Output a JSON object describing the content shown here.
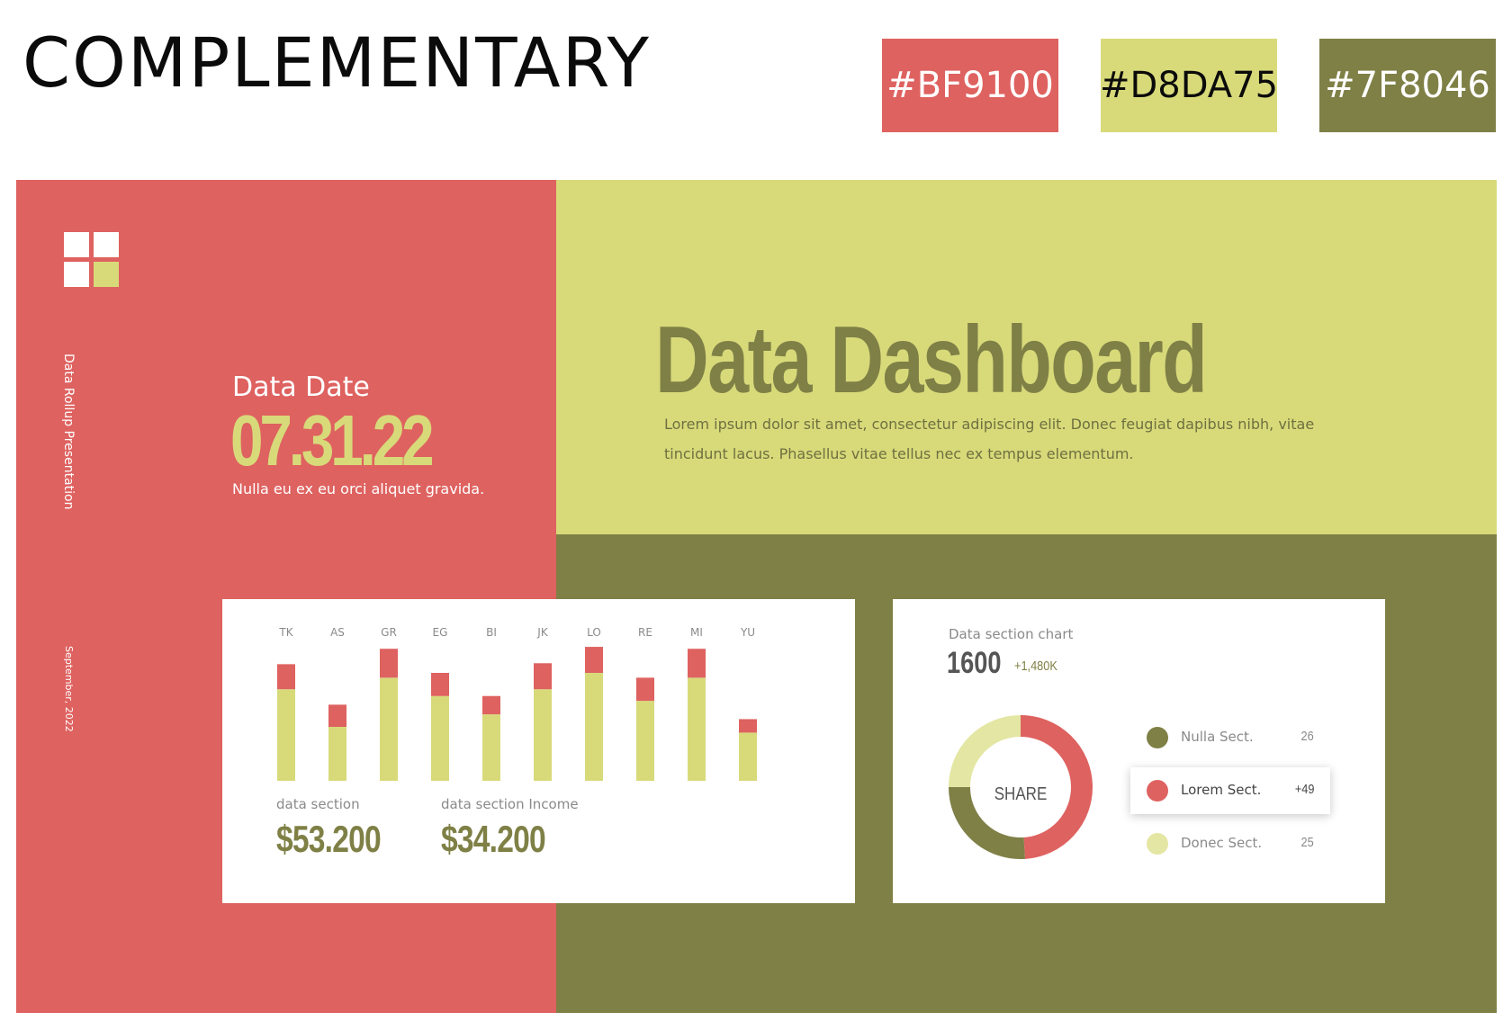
{
  "header": {
    "title": "COMPLEMENTARY",
    "swatches": [
      {
        "label": "#BF9100",
        "color": "#DE6260"
      },
      {
        "label": "#D8DA75",
        "color": "#D8DA7A"
      },
      {
        "label": "#7F8046",
        "color": "#7F8046"
      }
    ]
  },
  "sidebar": {
    "vertical_title": "Data Rollup Presentation",
    "vertical_date": "September, 2022"
  },
  "date_block": {
    "label": "Data Date",
    "value": "07.31.22",
    "subtitle": "Nulla eu ex eu orci aliquet gravida."
  },
  "dashboard": {
    "title": "Data Dashboard",
    "description": "Lorem ipsum dolor sit amet, consectetur adipiscing elit. Donec feugiat dapibus nibh, vitae tincidunt lacus. Phasellus vitae tellus nec ex tempus elementum."
  },
  "bar_card": {
    "stats": [
      {
        "label": "data section",
        "value": "$53.200"
      },
      {
        "label": "data section Income",
        "value": "$34.200"
      }
    ]
  },
  "pie_card": {
    "label": "Data section chart",
    "value": "1600",
    "change": "+1,480K",
    "center_label": "SHARE",
    "legend": [
      {
        "name": "Nulla Sect.",
        "value": "26",
        "color": "#7F8046"
      },
      {
        "name": "Lorem Sect.",
        "value": "+49",
        "color": "#DE6260"
      },
      {
        "name": "Donec Sect.",
        "value": "25",
        "color": "#E4E6A3"
      }
    ]
  },
  "colors": {
    "coral": "#DE6260",
    "lime": "#D8DA7A",
    "olive": "#7F8046"
  },
  "chart_data": [
    {
      "type": "bar",
      "stacked": true,
      "categories": [
        "TK",
        "AS",
        "GR",
        "EG",
        "BI",
        "JK",
        "LO",
        "RE",
        "MI",
        "YU"
      ],
      "series": [
        {
          "color": "#D8DA7A",
          "values": [
            95,
            56,
            107,
            88,
            69,
            95,
            112,
            83,
            107,
            50
          ]
        },
        {
          "color": "#DE6260",
          "values": [
            26,
            23,
            30,
            24,
            19,
            27,
            27,
            24,
            30,
            14
          ]
        }
      ],
      "ylim": [
        0,
        140
      ],
      "grid": false
    },
    {
      "type": "pie",
      "donut": true,
      "center_label": "SHARE",
      "slices": [
        {
          "value": 49,
          "color": "#DE6260"
        },
        {
          "value": 26,
          "color": "#7F8046"
        },
        {
          "value": 25,
          "color": "#E4E6A3"
        }
      ]
    }
  ]
}
